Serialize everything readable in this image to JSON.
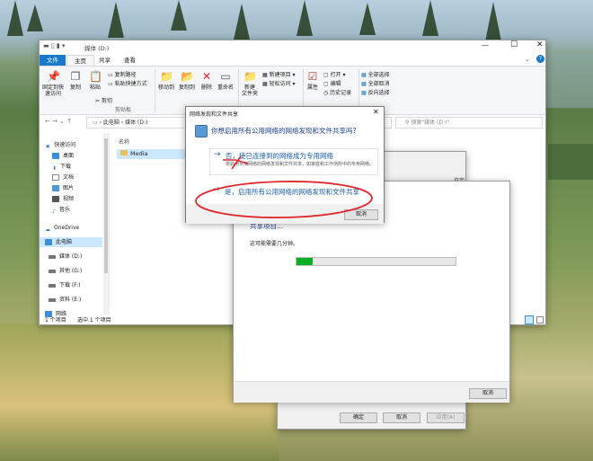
{
  "explorer": {
    "title": "媒体 (D:)",
    "tabs": [
      "文件",
      "主页",
      "共享",
      "查看"
    ],
    "ribbon": {
      "pin": "固定到快速访问",
      "copy": "复制",
      "paste": "粘贴",
      "copy_path": "复制路径",
      "paste_shortcut": "粘贴快捷方式",
      "cut": "剪切",
      "clipboard_group": "剪贴板",
      "move_to": "移动到",
      "copy_to": "复制到",
      "delete": "删除",
      "rename": "重命名",
      "new_folder": "新建\n文件夹",
      "new_item": "新建项目",
      "easy_access": "轻松访问",
      "properties": "属性",
      "open": "打开",
      "edit": "编辑",
      "history": "历史记录",
      "select_all": "全部选择",
      "select_none": "全部取消",
      "invert": "反向选择"
    },
    "breadcrumb": [
      "此电脑",
      "媒体 (D:)"
    ],
    "search_placeholder": "搜索\"媒体 (D:)\"",
    "column_name": "名称",
    "files": [
      "Media"
    ],
    "nav": [
      {
        "label": "快速访问",
        "icon": "star-icon"
      },
      {
        "label": "桌面",
        "icon": "desktop-icon"
      },
      {
        "label": "下载",
        "icon": "download-icon"
      },
      {
        "label": "文档",
        "icon": "document-icon"
      },
      {
        "label": "图片",
        "icon": "picture-icon"
      },
      {
        "label": "视频",
        "icon": "video-icon"
      },
      {
        "label": "音乐",
        "icon": "music-icon"
      },
      {
        "label": "OneDrive",
        "icon": "cloud-icon"
      },
      {
        "label": "此电脑",
        "icon": "computer-icon"
      },
      {
        "label": "媒体 (D:)",
        "icon": "drive-icon"
      },
      {
        "label": "其他 (G:)",
        "icon": "drive-icon"
      },
      {
        "label": "下载 (F:)",
        "icon": "drive-icon"
      },
      {
        "label": "资料 (E:)",
        "icon": "drive-icon"
      },
      {
        "label": "网络",
        "icon": "network-icon"
      }
    ],
    "status_count": "1 个项目",
    "status_selected": "选中 1 个项目"
  },
  "dialog": {
    "title": "网络发现和文件共享",
    "question": "你想启用所有公用网络的网络发现和文件共享吗?",
    "option_no_title": "否，使已连接到的网络成为专用网络",
    "option_no_desc": "将启用专用网络的网络发现和文件共享，如家庭和工作场所中的专用网络。",
    "option_yes_title": "是，启用所有公用网络的网络发现和文件共享",
    "cancel": "取消"
  },
  "progress_window": {
    "partial_title": "共享项目...",
    "subtitle": "这可能需要几分钟。",
    "progress": 0.1,
    "cancel": "取消",
    "back_title_fragment": "自定义"
  },
  "props_window": {
    "ok": "确定",
    "cancel": "取消",
    "apply": "应用(A)"
  },
  "colors": {
    "accent": "#1a73c9",
    "progress": "#06b025",
    "annotation": "#e0282e"
  }
}
